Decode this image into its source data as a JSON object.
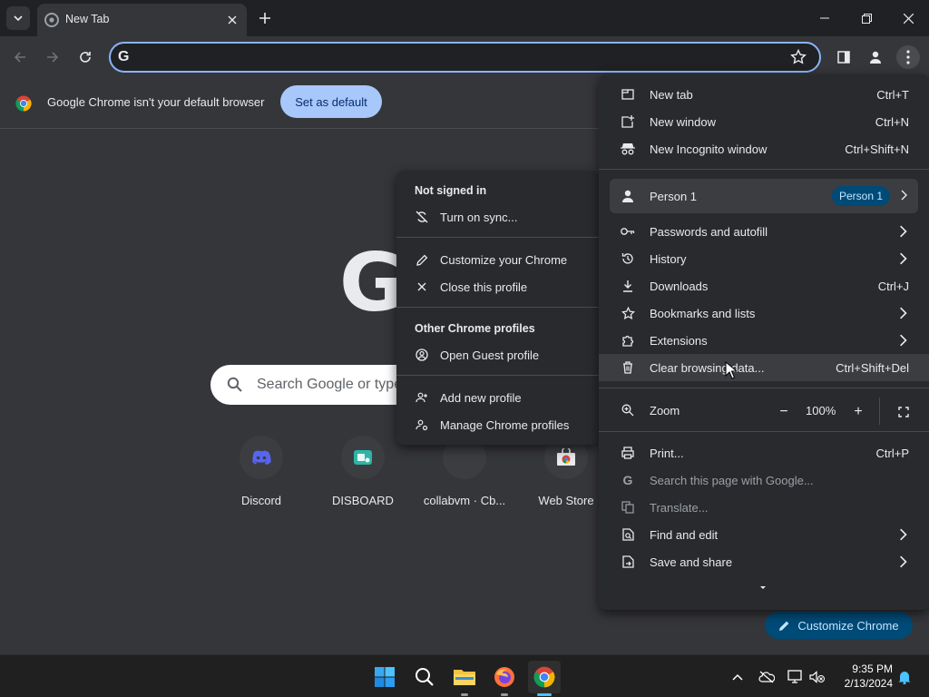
{
  "tab": {
    "title": "New Tab"
  },
  "omnibox": {
    "value": ""
  },
  "infobar": {
    "message": "Google Chrome isn't your default browser",
    "button": "Set as default"
  },
  "ntp": {
    "search_placeholder": "Search Google or type a URL",
    "logo_letter": "G",
    "shortcuts": [
      {
        "label": "Discord",
        "icon": "discord-icon"
      },
      {
        "label": "DISBOARD",
        "icon": "disboard-icon"
      },
      {
        "label": "collabvm · Cb...",
        "icon": "collabvm-icon"
      },
      {
        "label": "Web Store",
        "icon": "web-store-icon"
      }
    ],
    "customize_button": "Customize Chrome"
  },
  "menu": {
    "new_tab": {
      "label": "New tab",
      "shortcut": "Ctrl+T"
    },
    "new_window": {
      "label": "New window",
      "shortcut": "Ctrl+N"
    },
    "new_incognito": {
      "label": "New Incognito window",
      "shortcut": "Ctrl+Shift+N"
    },
    "person": {
      "label": "Person 1",
      "badge": "Person 1"
    },
    "passwords": {
      "label": "Passwords and autofill"
    },
    "history": {
      "label": "History"
    },
    "downloads": {
      "label": "Downloads",
      "shortcut": "Ctrl+J"
    },
    "bookmarks": {
      "label": "Bookmarks and lists"
    },
    "extensions": {
      "label": "Extensions"
    },
    "clear_data": {
      "label": "Clear browsing data...",
      "shortcut": "Ctrl+Shift+Del"
    },
    "zoom": {
      "label": "Zoom",
      "value": "100%",
      "minus": "−",
      "plus": "+"
    },
    "print": {
      "label": "Print...",
      "shortcut": "Ctrl+P"
    },
    "search_page": {
      "label": "Search this page with Google..."
    },
    "translate": {
      "label": "Translate..."
    },
    "find_edit": {
      "label": "Find and edit"
    },
    "save_share": {
      "label": "Save and share"
    }
  },
  "profile_menu": {
    "heading": "Not signed in",
    "turn_on_sync": "Turn on sync...",
    "customize": "Customize your Chrome",
    "close_profile": "Close this profile",
    "other_heading": "Other Chrome profiles",
    "guest": "Open Guest profile",
    "add_profile": "Add new profile",
    "manage": "Manage Chrome profiles"
  },
  "taskbar": {
    "time": "9:35 PM",
    "date": "2/13/2024",
    "apps": [
      "windows-start-icon",
      "search-icon",
      "file-explorer-icon",
      "firefox-icon",
      "chrome-icon"
    ]
  },
  "colors": {
    "accent": "#8ab4f8",
    "menu_bg": "#292a2d",
    "page_bg": "#35363a",
    "set_default_bg": "#a8c7fa",
    "badge_bg": "#004a77"
  }
}
